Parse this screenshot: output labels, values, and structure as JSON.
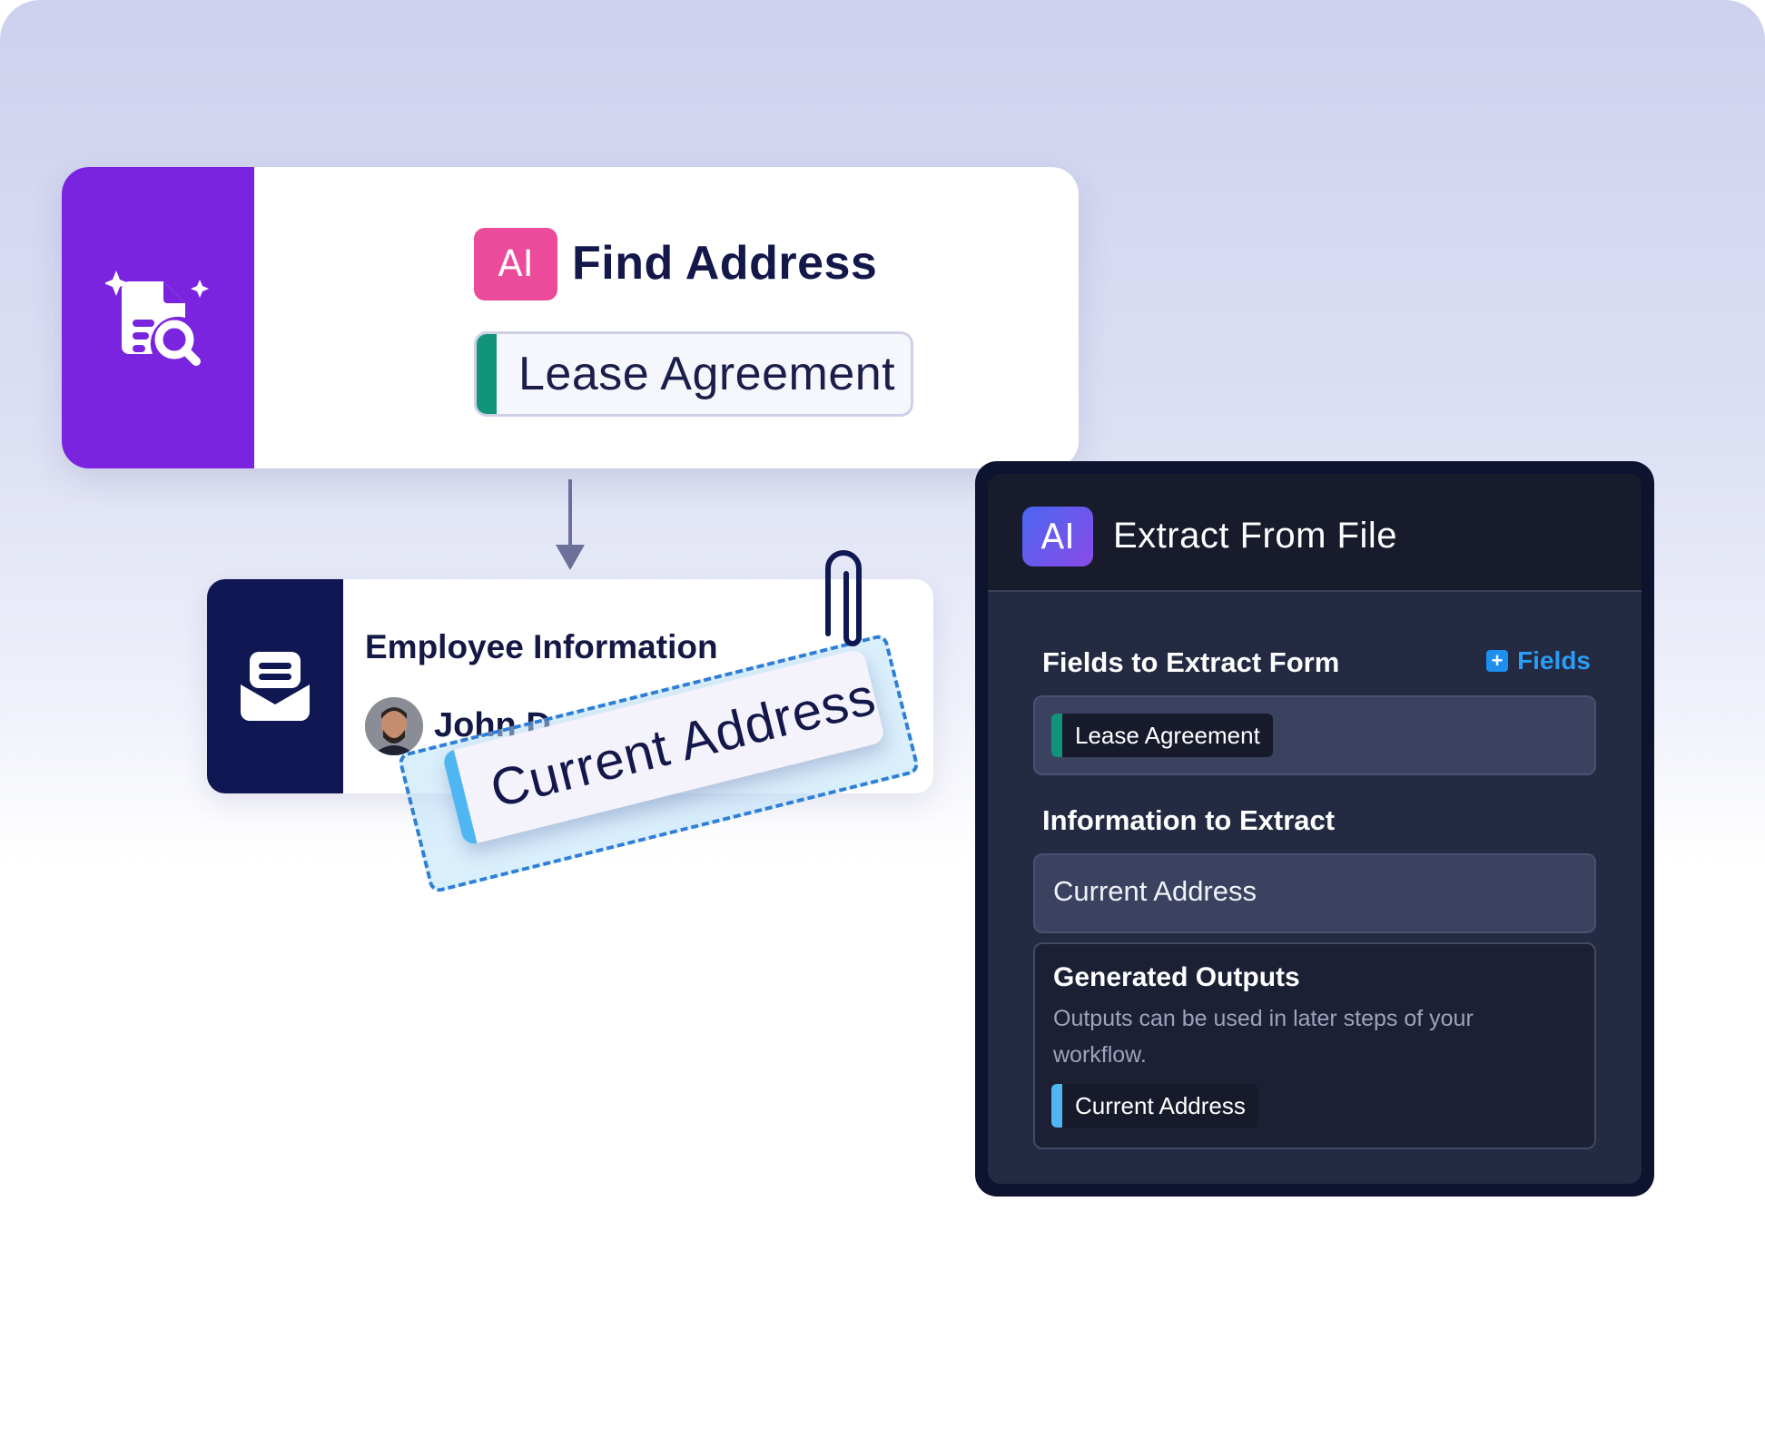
{
  "find_card": {
    "badge": "AI",
    "title": "Find Address",
    "chip_label": "Lease Agreement",
    "icon": "document-search-sparkle-icon",
    "colors": {
      "panel": "#7a24e0",
      "badge": "#ec4b9b",
      "chip_bar": "#12937b"
    }
  },
  "employee_card": {
    "title": "Employee Information",
    "name": "John D",
    "icon": "envelope-open-icon",
    "colors": {
      "panel": "#0f1852"
    }
  },
  "drag_tag": {
    "label": "Current Address",
    "icon": "paperclip-icon",
    "colors": {
      "bar": "#4fb6f2",
      "dash": "#2f7fd6"
    }
  },
  "extract_panel": {
    "badge": "AI",
    "title": "Extract From File",
    "fields_section": "Fields to Extract Form",
    "fields_button": "Fields",
    "fields_chip": "Lease Agreement",
    "info_section": "Information to Extract",
    "info_value": "Current Address",
    "outputs_title": "Generated Outputs",
    "outputs_desc": "Outputs can be used in later steps of your workflow.",
    "outputs_chip": "Current Address",
    "colors": {
      "accent": "#1d8fee",
      "chip_green": "#12937b",
      "chip_blue": "#4fb6f2"
    }
  }
}
